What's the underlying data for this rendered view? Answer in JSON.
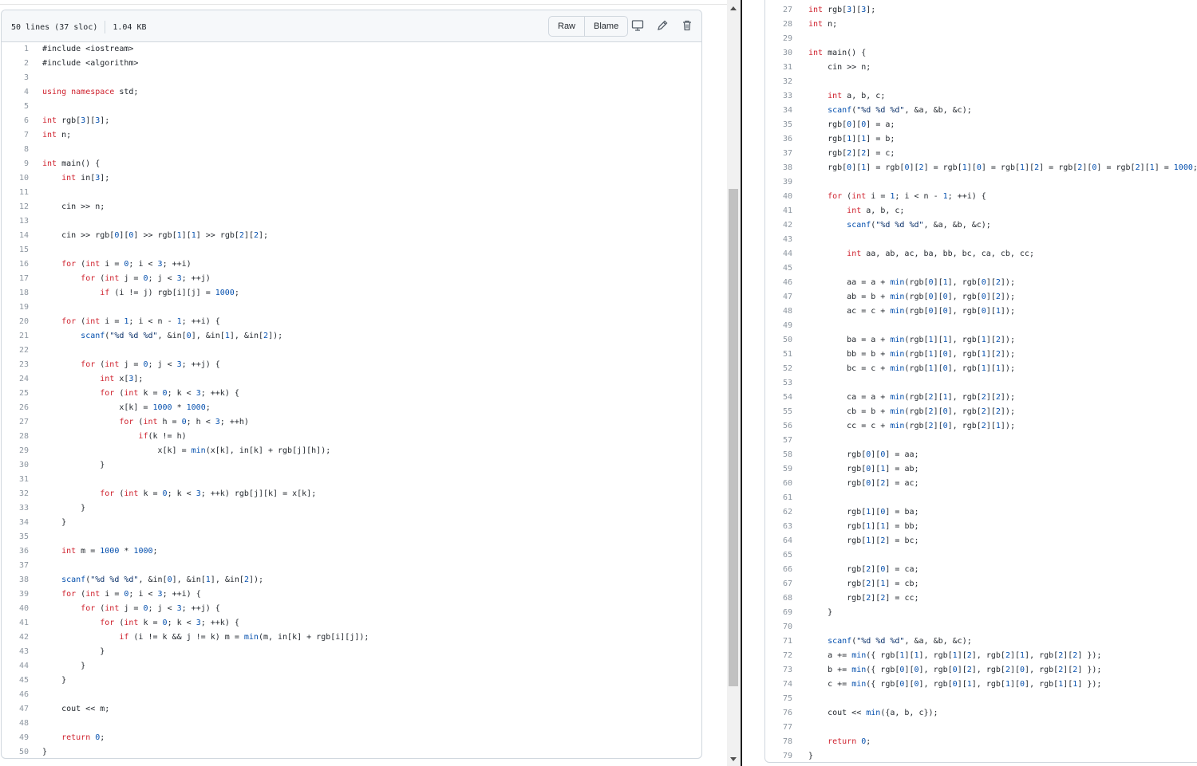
{
  "file_header": {
    "lines_info": "50 lines (37 sloc)",
    "size": "1.04 KB",
    "raw_label": "Raw",
    "blame_label": "Blame",
    "icons": [
      "desktop-icon",
      "pencil-icon",
      "trash-icon"
    ]
  },
  "left_code": {
    "lines": [
      {
        "n": "1",
        "t": "#include <iostream>"
      },
      {
        "n": "2",
        "t": "#include <algorithm>"
      },
      {
        "n": "3",
        "t": ""
      },
      {
        "n": "4",
        "t": "using namespace std;"
      },
      {
        "n": "5",
        "t": ""
      },
      {
        "n": "6",
        "t": "int rgb[3][3];"
      },
      {
        "n": "7",
        "t": "int n;"
      },
      {
        "n": "8",
        "t": ""
      },
      {
        "n": "9",
        "t": "int main() {"
      },
      {
        "n": "10",
        "t": "    int in[3];"
      },
      {
        "n": "11",
        "t": ""
      },
      {
        "n": "12",
        "t": "    cin >> n;"
      },
      {
        "n": "13",
        "t": ""
      },
      {
        "n": "14",
        "t": "    cin >> rgb[0][0] >> rgb[1][1] >> rgb[2][2];"
      },
      {
        "n": "15",
        "t": ""
      },
      {
        "n": "16",
        "t": "    for (int i = 0; i < 3; ++i)"
      },
      {
        "n": "17",
        "t": "        for (int j = 0; j < 3; ++j)"
      },
      {
        "n": "18",
        "t": "            if (i != j) rgb[i][j] = 1000;"
      },
      {
        "n": "19",
        "t": ""
      },
      {
        "n": "20",
        "t": "    for (int i = 1; i < n - 1; ++i) {"
      },
      {
        "n": "21",
        "t": "        scanf(\"%d %d %d\", &in[0], &in[1], &in[2]);"
      },
      {
        "n": "22",
        "t": ""
      },
      {
        "n": "23",
        "t": "        for (int j = 0; j < 3; ++j) {"
      },
      {
        "n": "24",
        "t": "            int x[3];"
      },
      {
        "n": "25",
        "t": "            for (int k = 0; k < 3; ++k) {"
      },
      {
        "n": "26",
        "t": "                x[k] = 1000 * 1000;"
      },
      {
        "n": "27",
        "t": "                for (int h = 0; h < 3; ++h)"
      },
      {
        "n": "28",
        "t": "                    if(k != h)"
      },
      {
        "n": "29",
        "t": "                        x[k] = min(x[k], in[k] + rgb[j][h]);"
      },
      {
        "n": "30",
        "t": "            }"
      },
      {
        "n": "31",
        "t": ""
      },
      {
        "n": "32",
        "t": "            for (int k = 0; k < 3; ++k) rgb[j][k] = x[k];"
      },
      {
        "n": "33",
        "t": "        }"
      },
      {
        "n": "34",
        "t": "    }"
      },
      {
        "n": "35",
        "t": ""
      },
      {
        "n": "36",
        "t": "    int m = 1000 * 1000;"
      },
      {
        "n": "37",
        "t": ""
      },
      {
        "n": "38",
        "t": "    scanf(\"%d %d %d\", &in[0], &in[1], &in[2]);"
      },
      {
        "n": "39",
        "t": "    for (int i = 0; i < 3; ++i) {"
      },
      {
        "n": "40",
        "t": "        for (int j = 0; j < 3; ++j) {"
      },
      {
        "n": "41",
        "t": "            for (int k = 0; k < 3; ++k) {"
      },
      {
        "n": "42",
        "t": "                if (i != k && j != k) m = min(m, in[k] + rgb[i][j]);"
      },
      {
        "n": "43",
        "t": "            }"
      },
      {
        "n": "44",
        "t": "        }"
      },
      {
        "n": "45",
        "t": "    }"
      },
      {
        "n": "46",
        "t": ""
      },
      {
        "n": "47",
        "t": "    cout << m;"
      },
      {
        "n": "48",
        "t": ""
      },
      {
        "n": "49",
        "t": "    return 0;"
      },
      {
        "n": "50",
        "t": "}"
      }
    ]
  },
  "right_code": {
    "lines": [
      {
        "n": "27",
        "t": "int rgb[3][3];"
      },
      {
        "n": "28",
        "t": "int n;"
      },
      {
        "n": "29",
        "t": ""
      },
      {
        "n": "30",
        "t": "int main() {"
      },
      {
        "n": "31",
        "t": "    cin >> n;"
      },
      {
        "n": "32",
        "t": ""
      },
      {
        "n": "33",
        "t": "    int a, b, c;"
      },
      {
        "n": "34",
        "t": "    scanf(\"%d %d %d\", &a, &b, &c);"
      },
      {
        "n": "35",
        "t": "    rgb[0][0] = a;"
      },
      {
        "n": "36",
        "t": "    rgb[1][1] = b;"
      },
      {
        "n": "37",
        "t": "    rgb[2][2] = c;"
      },
      {
        "n": "38",
        "t": "    rgb[0][1] = rgb[0][2] = rgb[1][0] = rgb[1][2] = rgb[2][0] = rgb[2][1] = 1000;"
      },
      {
        "n": "39",
        "t": ""
      },
      {
        "n": "40",
        "t": "    for (int i = 1; i < n - 1; ++i) {"
      },
      {
        "n": "41",
        "t": "        int a, b, c;"
      },
      {
        "n": "42",
        "t": "        scanf(\"%d %d %d\", &a, &b, &c);"
      },
      {
        "n": "43",
        "t": ""
      },
      {
        "n": "44",
        "t": "        int aa, ab, ac, ba, bb, bc, ca, cb, cc;"
      },
      {
        "n": "45",
        "t": ""
      },
      {
        "n": "46",
        "t": "        aa = a + min(rgb[0][1], rgb[0][2]);"
      },
      {
        "n": "47",
        "t": "        ab = b + min(rgb[0][0], rgb[0][2]);"
      },
      {
        "n": "48",
        "t": "        ac = c + min(rgb[0][0], rgb[0][1]);"
      },
      {
        "n": "49",
        "t": ""
      },
      {
        "n": "50",
        "t": "        ba = a + min(rgb[1][1], rgb[1][2]);"
      },
      {
        "n": "51",
        "t": "        bb = b + min(rgb[1][0], rgb[1][2]);"
      },
      {
        "n": "52",
        "t": "        bc = c + min(rgb[1][0], rgb[1][1]);"
      },
      {
        "n": "53",
        "t": ""
      },
      {
        "n": "54",
        "t": "        ca = a + min(rgb[2][1], rgb[2][2]);"
      },
      {
        "n": "55",
        "t": "        cb = b + min(rgb[2][0], rgb[2][2]);"
      },
      {
        "n": "56",
        "t": "        cc = c + min(rgb[2][0], rgb[2][1]);"
      },
      {
        "n": "57",
        "t": ""
      },
      {
        "n": "58",
        "t": "        rgb[0][0] = aa;"
      },
      {
        "n": "59",
        "t": "        rgb[0][1] = ab;"
      },
      {
        "n": "60",
        "t": "        rgb[0][2] = ac;"
      },
      {
        "n": "61",
        "t": ""
      },
      {
        "n": "62",
        "t": "        rgb[1][0] = ba;"
      },
      {
        "n": "63",
        "t": "        rgb[1][1] = bb;"
      },
      {
        "n": "64",
        "t": "        rgb[1][2] = bc;"
      },
      {
        "n": "65",
        "t": ""
      },
      {
        "n": "66",
        "t": "        rgb[2][0] = ca;"
      },
      {
        "n": "67",
        "t": "        rgb[2][1] = cb;"
      },
      {
        "n": "68",
        "t": "        rgb[2][2] = cc;"
      },
      {
        "n": "69",
        "t": "    }"
      },
      {
        "n": "70",
        "t": ""
      },
      {
        "n": "71",
        "t": "    scanf(\"%d %d %d\", &a, &b, &c);"
      },
      {
        "n": "72",
        "t": "    a += min({ rgb[1][1], rgb[1][2], rgb[2][1], rgb[2][2] });"
      },
      {
        "n": "73",
        "t": "    b += min({ rgb[0][0], rgb[0][2], rgb[2][0], rgb[2][2] });"
      },
      {
        "n": "74",
        "t": "    c += min({ rgb[0][0], rgb[0][1], rgb[1][0], rgb[1][1] });"
      },
      {
        "n": "75",
        "t": ""
      },
      {
        "n": "76",
        "t": "    cout << min({a, b, c});"
      },
      {
        "n": "77",
        "t": ""
      },
      {
        "n": "78",
        "t": "    return 0;"
      },
      {
        "n": "79",
        "t": "}"
      }
    ]
  },
  "syntax_colors": {
    "keyword": "#cf222e",
    "function": "#0550ae",
    "number": "#0550ae",
    "string": "#0a3069",
    "text": "#24292f",
    "line_number": "#8c959f"
  }
}
